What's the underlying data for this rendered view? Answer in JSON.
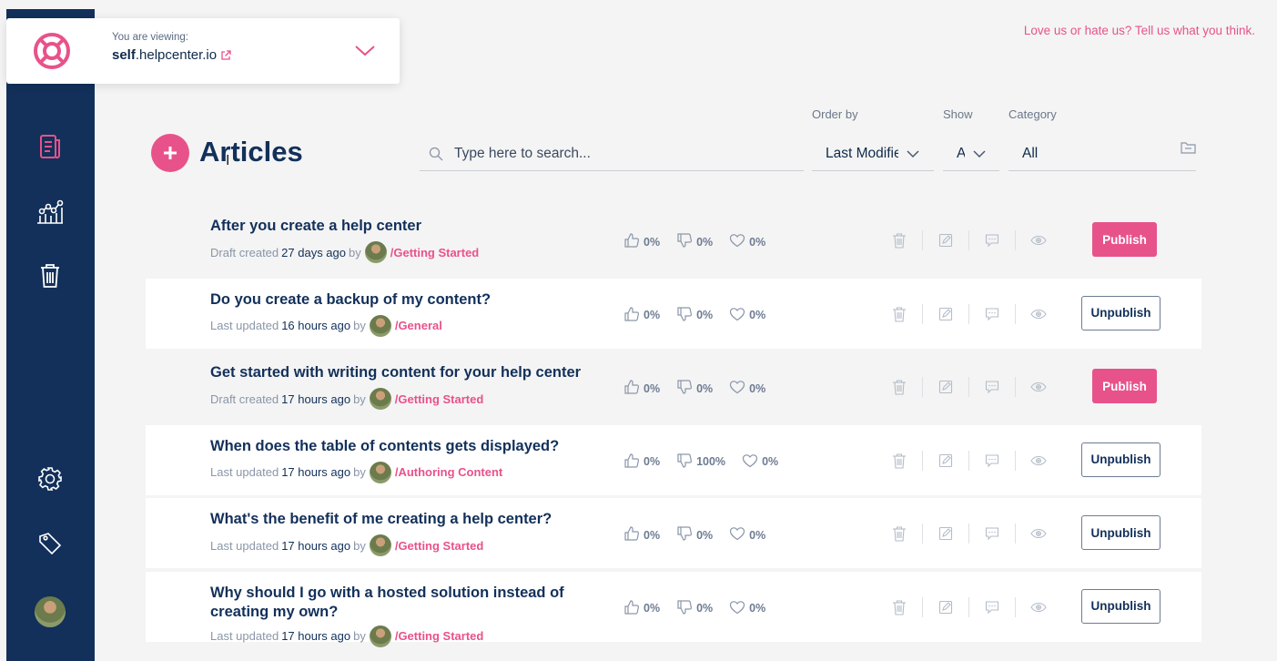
{
  "header": {
    "viewing_label": "You are viewing:",
    "site_bold": "self",
    "site_rest": ".helpcenter.io",
    "feedback": "Love us or hate us? Tell us what you think."
  },
  "page": {
    "title": "Articles",
    "search_placeholder": "Type here to search...",
    "filters": {
      "order_label": "Order by",
      "order_value": "Last Modified",
      "show_label": "Show",
      "show_value": "All",
      "category_label": "Category",
      "category_value": "All"
    }
  },
  "articles": [
    {
      "title": "After you create a help center",
      "status": "Draft created",
      "when": "27 days ago",
      "by": "by",
      "category": "/Getting Started",
      "likes": "0%",
      "dislikes": "0%",
      "hearts": "0%",
      "action": "Publish",
      "published": false
    },
    {
      "title": "Do you create a backup of my content?",
      "status": "Last updated",
      "when": "16 hours ago",
      "by": "by",
      "category": "/General",
      "likes": "0%",
      "dislikes": "0%",
      "hearts": "0%",
      "action": "Unpublish",
      "published": true
    },
    {
      "title": "Get started with writing content for your help center",
      "status": "Draft created",
      "when": "17 hours ago",
      "by": "by",
      "category": "/Getting Started",
      "likes": "0%",
      "dislikes": "0%",
      "hearts": "0%",
      "action": "Publish",
      "published": false
    },
    {
      "title": "When does the table of contents gets displayed?",
      "status": "Last updated",
      "when": "17 hours ago",
      "by": "by",
      "category": "/Authoring Content",
      "likes": "0%",
      "dislikes": "100%",
      "hearts": "0%",
      "action": "Unpublish",
      "published": true
    },
    {
      "title": "What's the benefit of me creating a help center?",
      "status": "Last updated",
      "when": "17 hours ago",
      "by": "by",
      "category": "/Getting Started",
      "likes": "0%",
      "dislikes": "0%",
      "hearts": "0%",
      "action": "Unpublish",
      "published": true
    },
    {
      "title": "Why should I go with a hosted solution instead of creating my own?",
      "status": "Last updated",
      "when": "17 hours ago",
      "by": "by",
      "category": "/Getting Started",
      "likes": "0%",
      "dislikes": "0%",
      "hearts": "0%",
      "action": "Unpublish",
      "published": true
    }
  ],
  "sidebar": {
    "items": [
      {
        "icon": "articles-icon"
      },
      {
        "icon": "analytics-icon"
      },
      {
        "icon": "trash-icon"
      },
      {
        "icon": "settings-icon"
      },
      {
        "icon": "tag-icon"
      },
      {
        "icon": "user-avatar"
      }
    ]
  },
  "colors": {
    "brand_pink": "#e8528a",
    "sidebar_navy": "#12305a"
  }
}
